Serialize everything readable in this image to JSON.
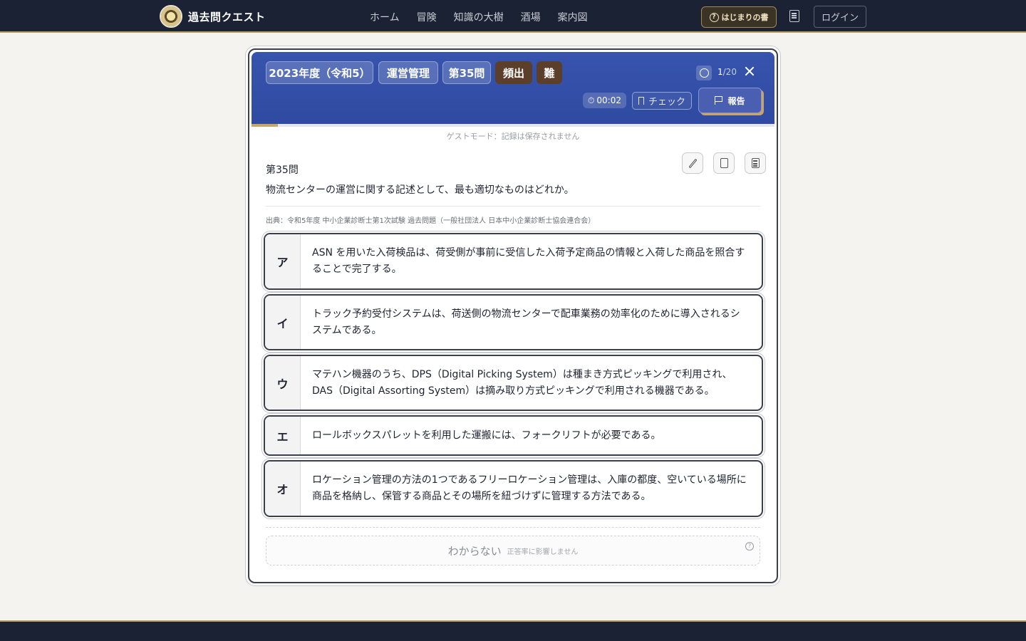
{
  "app": {
    "brand": "過去問クエスト",
    "nav": [
      "ホーム",
      "冒険",
      "知識の大樹",
      "酒場",
      "案内図"
    ],
    "guide_button": "はじまりの書",
    "login_button": "ログイン"
  },
  "question_header": {
    "tags": [
      "2023年度（令和5）",
      "運営管理",
      "第35問",
      "頻出",
      "難"
    ],
    "counter_current": "1",
    "counter_total": "/20",
    "timer": "00:02",
    "check_button": "チェック",
    "report_button": "報告",
    "progress_fraction": 0.05
  },
  "guest_note": "ゲストモード：記録は保存されません",
  "question": {
    "number": "第35問",
    "text": "物流センターの運営に関する記述として、最も適切なものはどれか。",
    "source": "出典：令和5年度 中小企業診断士第1次試験 過去問題（一般社団法人 日本中小企業診断士協会連合会）"
  },
  "choices": [
    {
      "letter": "ア",
      "text": "ASN を用いた入荷検品は、荷受側が事前に受信した入荷予定商品の情報と入荷した商品を照合することで完了する。"
    },
    {
      "letter": "イ",
      "text": "トラック予約受付システムは、荷送側の物流センターで配車業務の効率化のために導入されるシステムである。"
    },
    {
      "letter": "ウ",
      "text": "マテハン機器のうち、DPS（Digital Picking System）は種まき方式ピッキングで利用され、DAS（Digital Assorting System）は摘み取り方式ピッキングで利用される機器である。"
    },
    {
      "letter": "エ",
      "text": "ロールボックスパレットを利用した運搬には、フォークリフトが必要である。"
    },
    {
      "letter": "オ",
      "text": "ロケーション管理の方法の1つであるフリーロケーション管理は、入庫の都度、空いている場所に商品を格納し、保管する商品とその場所を紐づけずに管理する方法である。"
    }
  ],
  "unknown": {
    "label": "わからない",
    "note": "正答率に影響しません"
  },
  "colors": {
    "header_blue": "#3754ae",
    "nav_dark": "#1b2233",
    "gold_accent": "#c7a66a",
    "tag_brown": "#5c3f2a"
  },
  "icons": [
    "app-logo",
    "help-circle-icon",
    "book-icon",
    "alarm-icon",
    "close-icon",
    "stopwatch-icon",
    "bookmark-icon",
    "flag-icon",
    "pencil-icon",
    "document-icon",
    "calculator-icon"
  ]
}
